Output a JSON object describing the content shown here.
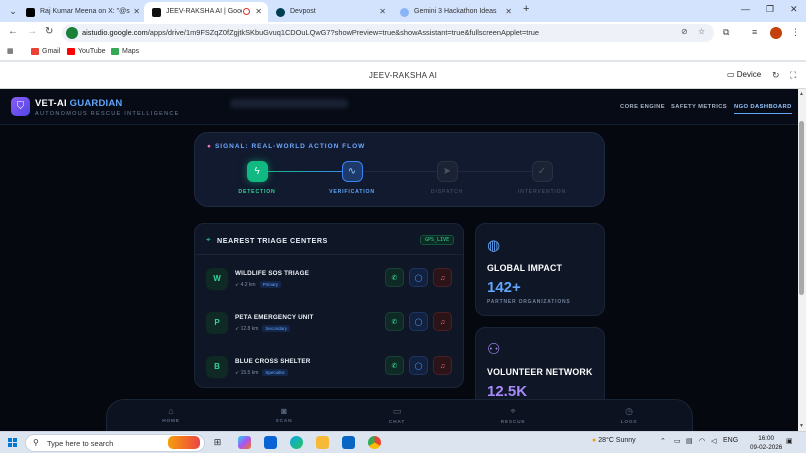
{
  "browser": {
    "tabs": [
      {
        "title": "Raj Kumar Meena on X: \"@sau",
        "color": "#000000"
      },
      {
        "title": "JEEV-RAKSHA AI | Google A",
        "color": "#111111"
      },
      {
        "title": "Devpost",
        "color": "#003e54"
      },
      {
        "title": "Gemini 3 Hackathon Ideas",
        "color": "#8ab4f8"
      }
    ],
    "url_host": "aistudio.google.com",
    "url_path": "/apps/drive/1m9FSZqZ0fZgjtkSKbuGvuq1CDOuLQwG7?showPreview=true&showAssistant=true&fullscreenApplet=true",
    "bookmarks": [
      "Gmail",
      "YouTube",
      "Maps"
    ]
  },
  "studio": {
    "title": "JEEV-RAKSHA AI",
    "device_label": "Device"
  },
  "app": {
    "brand_main": "VET-AI",
    "brand_accent": "GUARDIAN",
    "tagline": "AUTONOMOUS RESCUE INTELLIGENCE",
    "nav": [
      "CORE ENGINE",
      "SAFETY METRICS",
      "NGO DASHBOARD"
    ],
    "signal": {
      "title": "SIGNAL: REAL-WORLD ACTION FLOW",
      "steps": [
        "DETECTION",
        "VERIFICATION",
        "DISPATCH",
        "INTERVENTION"
      ]
    },
    "triage": {
      "title": "NEAREST TRIAGE CENTERS",
      "badge": "GPS_LIVE",
      "centers": [
        {
          "initial": "W",
          "name": "WILDLIFE SOS TRIAGE",
          "distance": "4.2 km",
          "tag": "Primary"
        },
        {
          "initial": "P",
          "name": "PETA EMERGENCY UNIT",
          "distance": "12.8 km",
          "tag": "Secondary"
        },
        {
          "initial": "B",
          "name": "BLUE CROSS SHELTER",
          "distance": "15.5 km",
          "tag": "Specialist"
        }
      ]
    },
    "stats": [
      {
        "title": "GLOBAL IMPACT",
        "value": "142+",
        "caption": "PARTNER ORGANIZATIONS",
        "color": "#60a5fa"
      },
      {
        "title": "VOLUNTEER NETWORK",
        "value": "12.5K",
        "caption": "",
        "color": "#a78bfa"
      }
    ],
    "bottom_nav": [
      "HOME",
      "SCAN",
      "CHAT",
      "RESCUE",
      "LOGS"
    ]
  },
  "taskbar": {
    "search_placeholder": "Type here to search",
    "weather": "28°C  Sunny",
    "lang": "ENG",
    "time": "16:00",
    "date": "09-02-2026"
  },
  "colors": {
    "accent_green": "#10b981",
    "accent_blue": "#60a5fa",
    "accent_purple": "#a78bfa",
    "app_bg": "#05080f"
  }
}
